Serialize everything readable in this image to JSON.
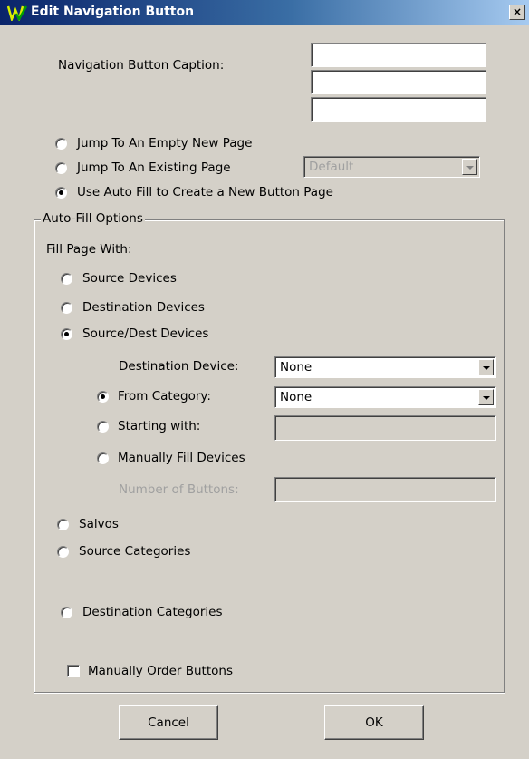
{
  "window": {
    "title": "Edit Navigation Button",
    "close_glyph": "×",
    "logo_icon": "app-logo-icon"
  },
  "caption": {
    "label": "Navigation Button Caption:",
    "lines": [
      "",
      "",
      ""
    ]
  },
  "page_mode": {
    "options": [
      {
        "label": "Jump To An Empty New Page",
        "selected": false
      },
      {
        "label": "Jump To An Existing Page",
        "selected": false
      },
      {
        "label": "Use Auto Fill to Create a New Button Page",
        "selected": true
      }
    ],
    "existing_page_value": "Default"
  },
  "auto_fill": {
    "group_label": "Auto-Fill Options",
    "fill_label": "Fill Page With:",
    "options": [
      {
        "label": "Source Devices",
        "selected": false
      },
      {
        "label": "Destination Devices",
        "selected": false
      },
      {
        "label": "Source/Dest Devices",
        "selected": true
      },
      {
        "label": "Salvos",
        "selected": false
      },
      {
        "label": "Source Categories",
        "selected": false
      },
      {
        "label": "Destination Categories",
        "selected": false
      }
    ],
    "destination_device_label": "Destination Device:",
    "destination_device_value": "None",
    "sub_options": [
      {
        "label": "From Category:",
        "selected": true
      },
      {
        "label": "Starting with:",
        "selected": false
      },
      {
        "label": "Manually Fill Devices",
        "selected": false
      }
    ],
    "from_category_value": "None",
    "starting_with_value": "",
    "number_of_buttons_label": "Number of Buttons:",
    "number_of_buttons_value": "",
    "manual_order_label": "Manually Order Buttons",
    "manual_order_checked": false
  },
  "buttons": {
    "cancel": "Cancel",
    "ok": "OK"
  }
}
